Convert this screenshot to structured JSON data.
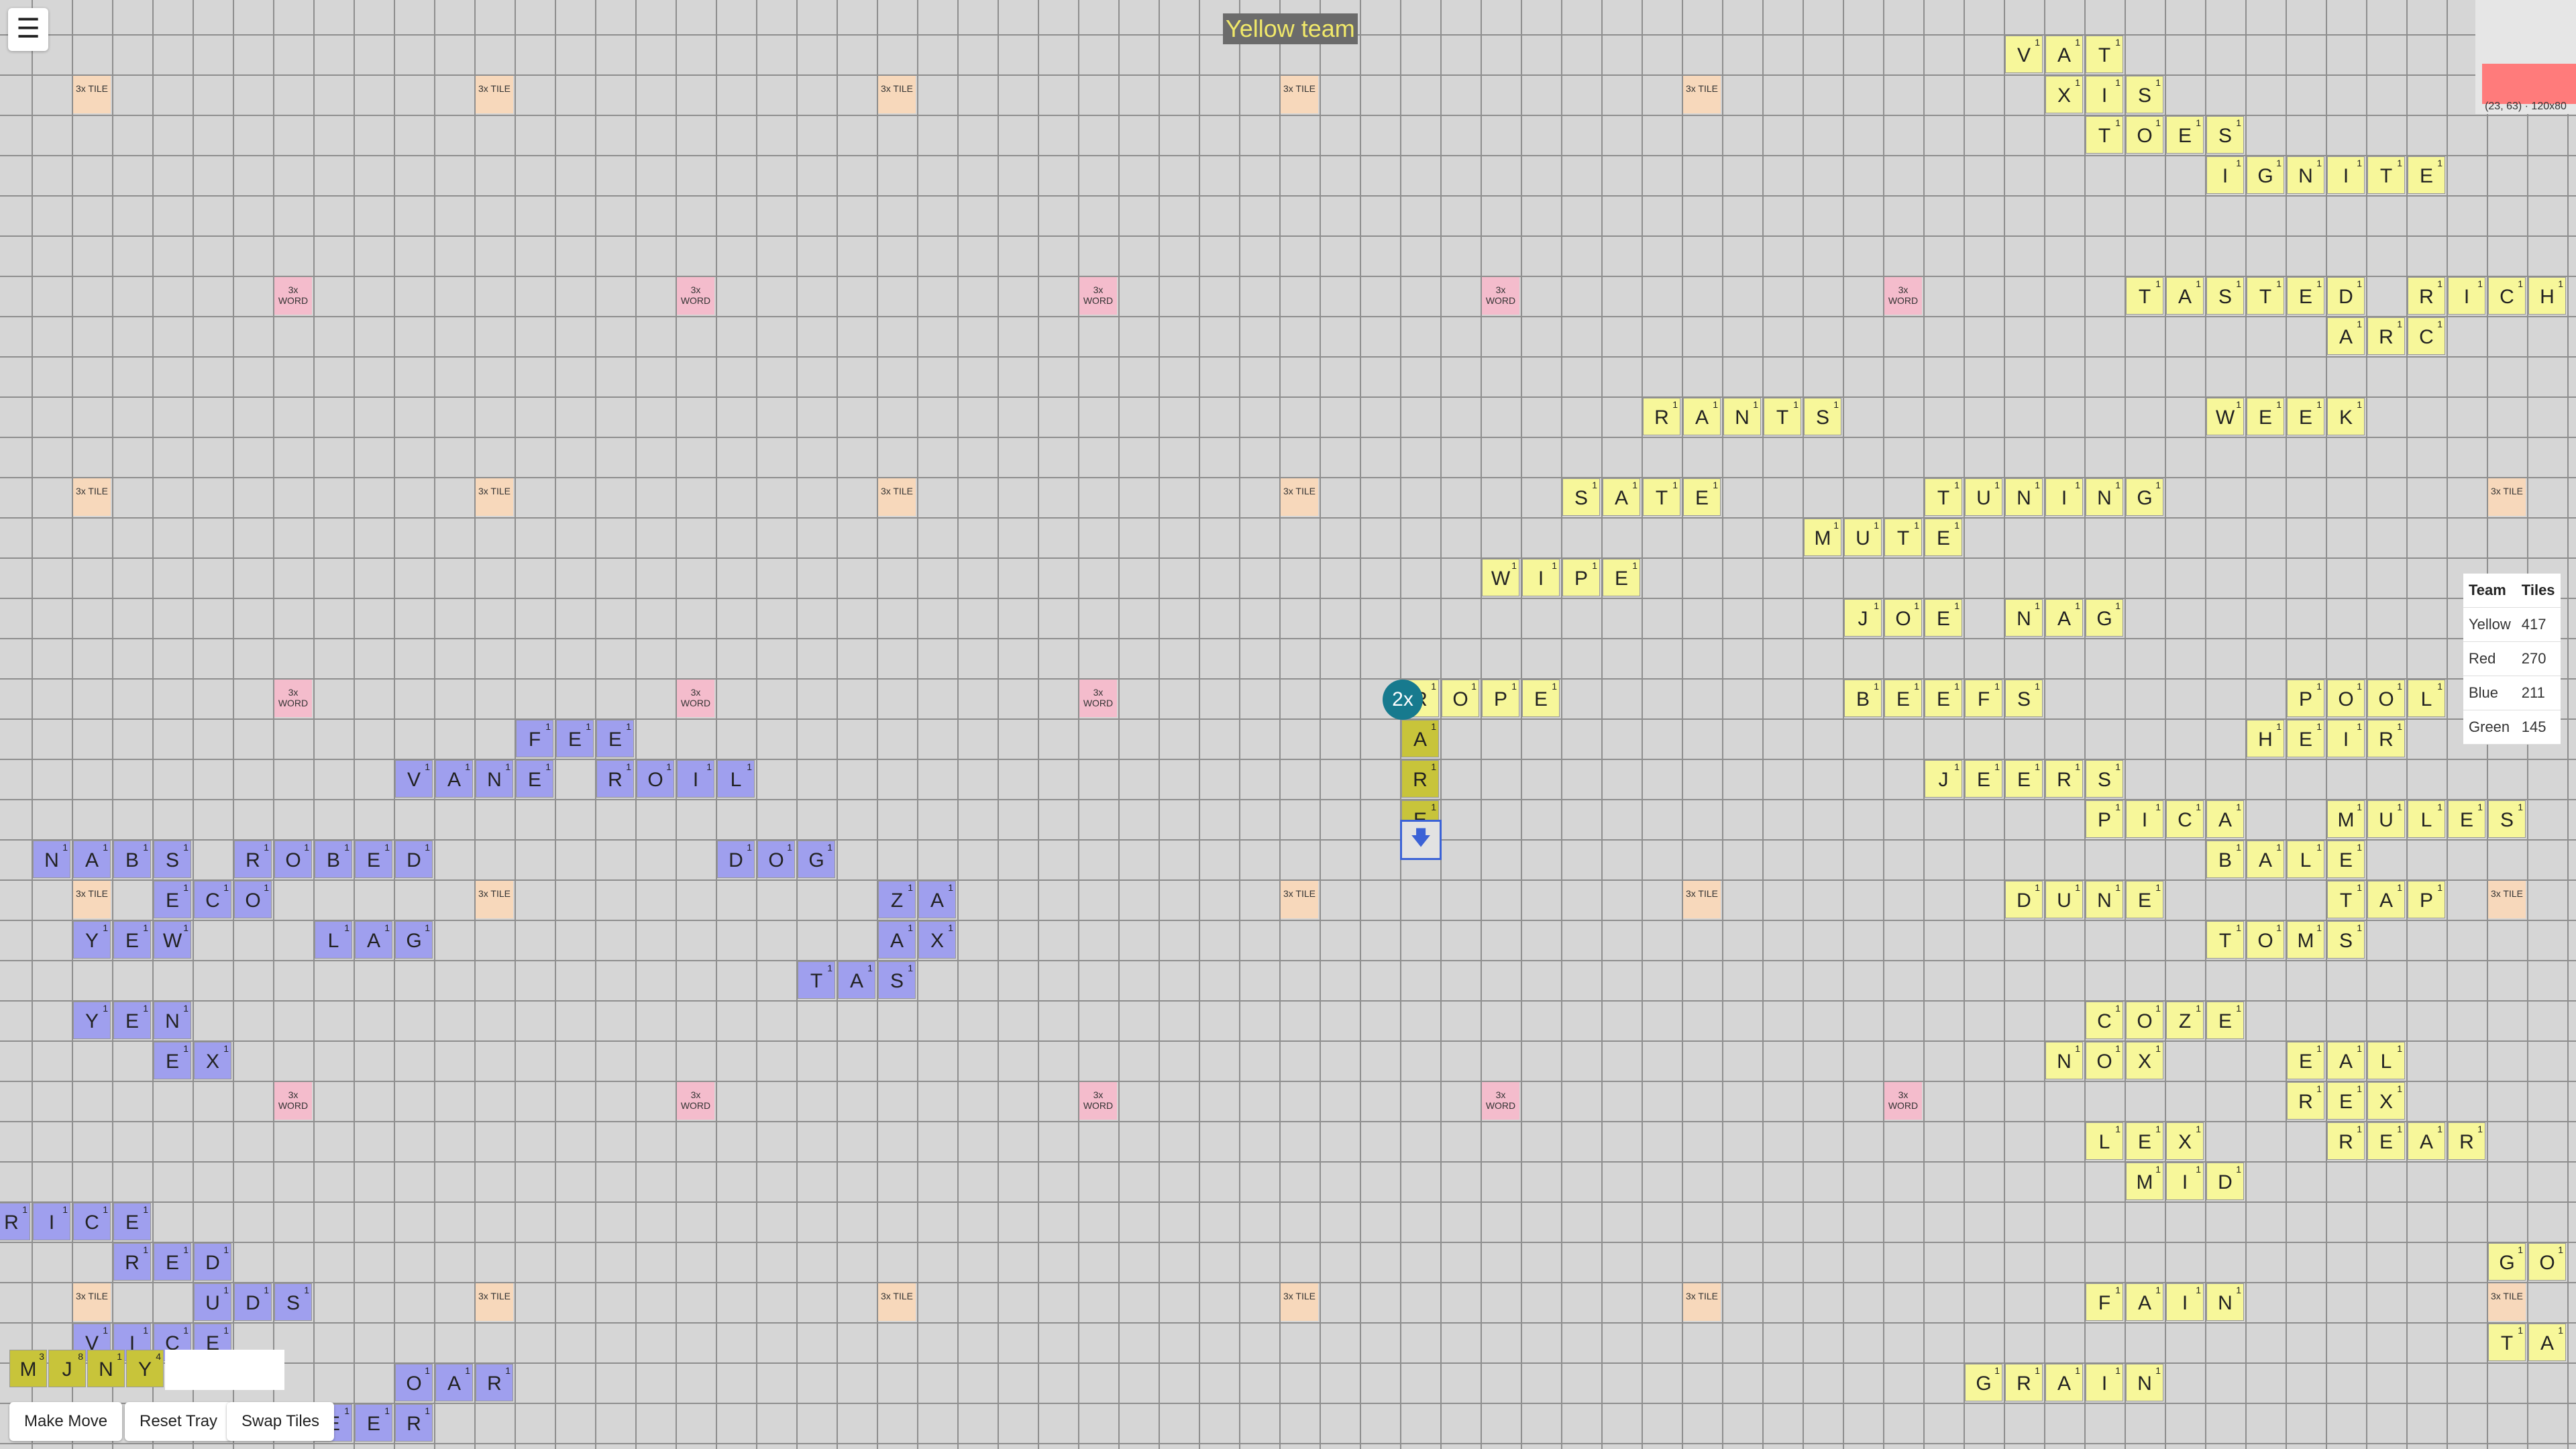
{
  "header": {
    "menu_icon_glyph": "☰",
    "current_team": "Yellow team"
  },
  "minimap": {
    "coords": "(23, 63) · 120x80"
  },
  "scoreboard": {
    "header_team": "Team",
    "header_tiles": "Tiles",
    "rows": [
      {
        "team": "Yellow",
        "tiles": "417"
      },
      {
        "team": "Red",
        "tiles": "270"
      },
      {
        "team": "Blue",
        "tiles": "211"
      },
      {
        "team": "Green",
        "tiles": "145"
      }
    ]
  },
  "multiplier_badge": "2x",
  "cursor_arrow": "🡇",
  "premium_labels": {
    "tile3": "3x TILE",
    "word3": "3x WORD"
  },
  "tray": {
    "tiles": [
      {
        "letter": "M",
        "value": "3"
      },
      {
        "letter": "J",
        "value": "8"
      },
      {
        "letter": "N",
        "value": "1"
      },
      {
        "letter": "Y",
        "value": "4"
      }
    ]
  },
  "buttons": {
    "make_move": "Make Move",
    "reset_tray": "Reset Tray",
    "swap_tiles": "Swap Tiles"
  },
  "board": {
    "current_word": [
      {
        "letter": "A",
        "value": "1"
      },
      {
        "letter": "R",
        "value": "1"
      },
      {
        "letter": "E",
        "value": "1"
      }
    ],
    "yellow_words": [
      "VAT",
      "XIS",
      "TOES",
      "IGNITE",
      "TASTED",
      "ARC",
      "RICH",
      "RANTS",
      "WEEK",
      "SATE",
      "TUNING",
      "MUTE",
      "WIPE",
      "JOE",
      "NAG",
      "ROPE",
      "BEEFS",
      "JEERS",
      "POOL",
      "HEIR",
      "PICA",
      "MULES",
      "BALE",
      "DUNE",
      "TAP",
      "TOMS",
      "COZE",
      "NOX",
      "EAL",
      "REX",
      "LEX",
      "REAR",
      "MID",
      "FAIN",
      "GRAIN",
      "GO",
      "TA"
    ],
    "blue_words": [
      "FEE",
      "VANE",
      "ROIL",
      "NABS",
      "ROBED",
      "DOG",
      "ECO",
      "ZA",
      "AX",
      "YEW",
      "LAG",
      "TAS",
      "YEN",
      "EX",
      "RICE",
      "RED",
      "UDS",
      "VICE",
      "OAR",
      "EER"
    ]
  }
}
